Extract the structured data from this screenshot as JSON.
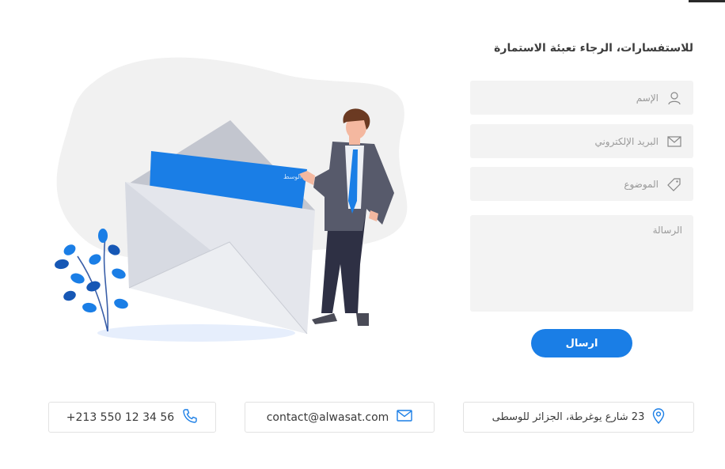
{
  "form": {
    "title": "للاستفسارات، الرجاء تعبئة الاستمارة",
    "name_placeholder": "الإسم",
    "email_placeholder": "البريد الإلكتروني",
    "subject_placeholder": "الموضوع",
    "message_placeholder": "الرسالة",
    "send_label": "ارسال"
  },
  "illustration": {
    "letter_brand": "الوسط"
  },
  "contact": {
    "phone": "+213 550 12 34 56",
    "email": "contact@alwasat.com",
    "address": "23 شارع يوغرطة، الجزائر للوسطى"
  },
  "colors": {
    "accent": "#1a7ee6",
    "field_bg": "#f3f3f3",
    "blob": "#f1f1f1"
  },
  "icons": {
    "name": "user-icon",
    "email": "envelope-icon",
    "subject": "tag-icon",
    "phone": "phone-icon",
    "contact_email": "mail-icon",
    "address": "location-pin-icon"
  }
}
